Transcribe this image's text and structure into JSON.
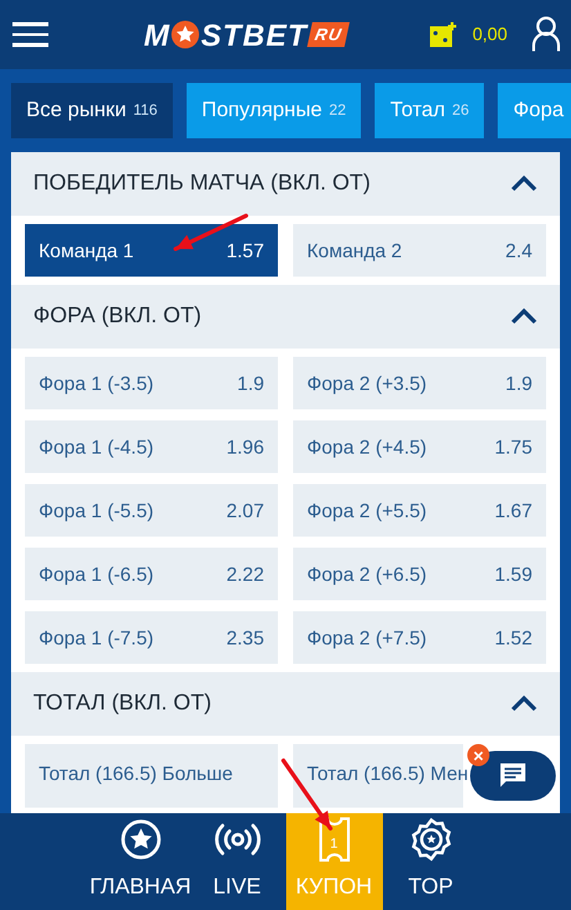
{
  "header": {
    "logo": {
      "before": "M",
      "after": "STBET",
      "suffix": "RU"
    },
    "balance": "0,00"
  },
  "market_tabs": [
    {
      "label": "Все рынки",
      "count": "116",
      "selected": true
    },
    {
      "label": "Популярные",
      "count": "22",
      "selected": false
    },
    {
      "label": "Тотал",
      "count": "26",
      "selected": false
    },
    {
      "label": "Фора",
      "selected": false
    }
  ],
  "sections": [
    {
      "title": "ПОБЕДИТЕЛЬ МАТЧА (ВКЛ. ОТ)",
      "expanded": true,
      "outcomes": [
        {
          "label": "Команда 1",
          "odds": "1.57",
          "selected": true
        },
        {
          "label": "Команда 2",
          "odds": "2.4",
          "selected": false
        }
      ]
    },
    {
      "title": "ФОРА (ВКЛ. ОТ)",
      "expanded": true,
      "outcomes": [
        {
          "label": "Фора 1 (-3.5)",
          "odds": "1.9",
          "selected": false
        },
        {
          "label": "Фора 2 (+3.5)",
          "odds": "1.9",
          "selected": false
        },
        {
          "label": "Фора 1 (-4.5)",
          "odds": "1.96",
          "selected": false
        },
        {
          "label": "Фора 2 (+4.5)",
          "odds": "1.75",
          "selected": false
        },
        {
          "label": "Фора 1 (-5.5)",
          "odds": "2.07",
          "selected": false
        },
        {
          "label": "Фора 2 (+5.5)",
          "odds": "1.67",
          "selected": false
        },
        {
          "label": "Фора 1 (-6.5)",
          "odds": "2.22",
          "selected": false
        },
        {
          "label": "Фора 2 (+6.5)",
          "odds": "1.59",
          "selected": false
        },
        {
          "label": "Фора 1 (-7.5)",
          "odds": "2.35",
          "selected": false
        },
        {
          "label": "Фора 2 (+7.5)",
          "odds": "1.52",
          "selected": false
        }
      ]
    },
    {
      "title": "ТОТАЛ (ВКЛ. ОТ)",
      "expanded": true,
      "outcomes": [
        {
          "label": "Тотал (166.5) Больше",
          "selected": false
        },
        {
          "label": "Тотал (166.5) Мен",
          "selected": false
        }
      ]
    }
  ],
  "chat_button": {
    "close": "×"
  },
  "bottom_nav": [
    {
      "kind": "star",
      "label": "ГЛАВНАЯ",
      "selected": false
    },
    {
      "kind": "live",
      "label": "LIVE",
      "selected": false
    },
    {
      "kind": "coupon",
      "label": "КУПОН",
      "badge": "1",
      "selected": true
    },
    {
      "kind": "top",
      "label": "TOP",
      "selected": false
    }
  ]
}
